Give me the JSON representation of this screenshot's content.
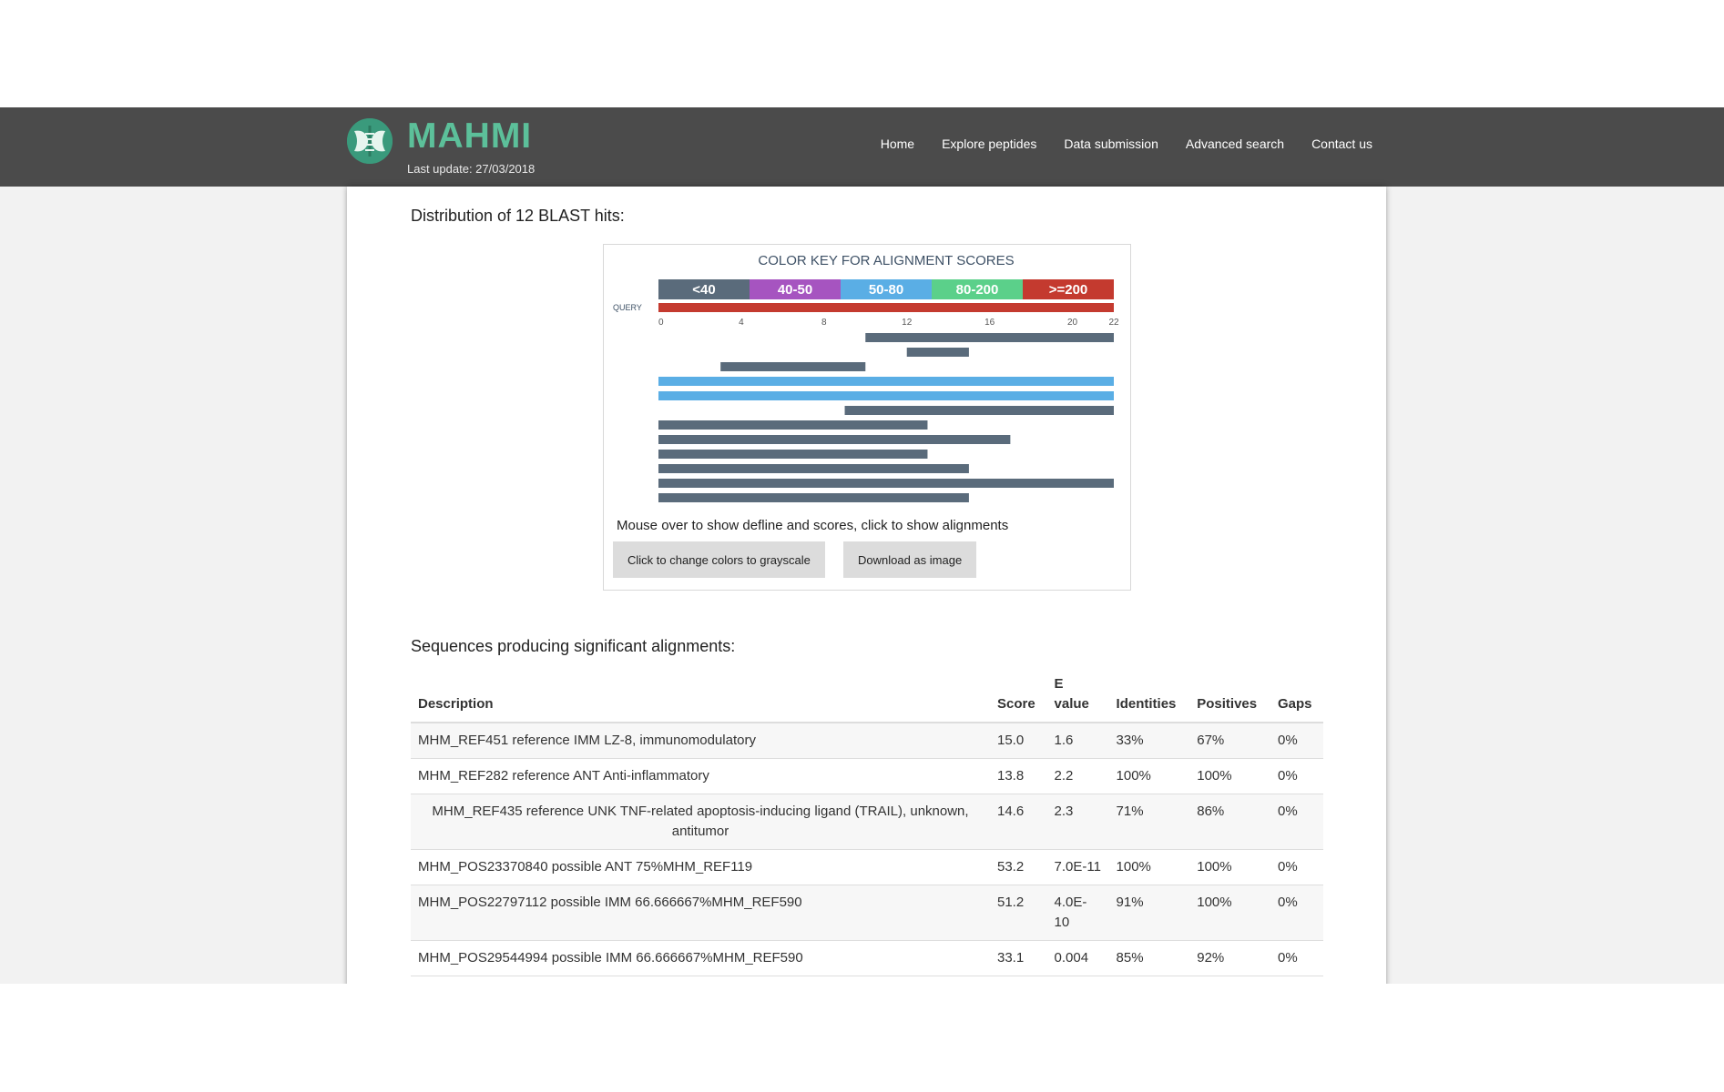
{
  "header": {
    "brand": "MAHMI",
    "last_update": "Last update: 27/03/2018",
    "nav": [
      "Home",
      "Explore peptides",
      "Data submission",
      "Advanced search",
      "Contact us"
    ]
  },
  "distribution": {
    "title": "Distribution of 12 BLAST hits:",
    "color_key_title": "COLOR KEY FOR ALIGNMENT SCORES",
    "score_bins": [
      {
        "label": "<40",
        "color": "#5a6b7b"
      },
      {
        "label": "40-50",
        "color": "#a654c0"
      },
      {
        "label": "50-80",
        "color": "#5aaee5"
      },
      {
        "label": "80-200",
        "color": "#5bd08a"
      },
      {
        "label": ">=200",
        "color": "#c43a2f"
      }
    ],
    "query_label": "QUERY",
    "query_color": "#c43a2f",
    "query_length": 22,
    "ticks": [
      "0",
      "4",
      "8",
      "12",
      "16",
      "20",
      "22"
    ],
    "hits": [
      {
        "start": 10,
        "end": 22,
        "bin": 0
      },
      {
        "start": 12,
        "end": 15,
        "bin": 0
      },
      {
        "start": 3,
        "end": 10,
        "bin": 0
      },
      {
        "start": 0,
        "end": 22,
        "bin": 2
      },
      {
        "start": 0,
        "end": 22,
        "bin": 2
      },
      {
        "start": 9,
        "end": 22,
        "bin": 0
      },
      {
        "start": 0,
        "end": 13,
        "bin": 0
      },
      {
        "start": 0,
        "end": 17,
        "bin": 0
      },
      {
        "start": 0,
        "end": 13,
        "bin": 0
      },
      {
        "start": 0,
        "end": 15,
        "bin": 0
      },
      {
        "start": 0,
        "end": 22,
        "bin": 0
      },
      {
        "start": 0,
        "end": 15,
        "bin": 0
      }
    ],
    "hint": "Mouse over to show defline and scores, click to show alignments",
    "grayscale_button": "Click to change colors to grayscale",
    "download_button": "Download as image"
  },
  "alignments": {
    "title": "Sequences producing significant alignments:",
    "columns": {
      "description": "Description",
      "score": "Score",
      "evalue_1": "E",
      "evalue_2": "value",
      "identities": "Identities",
      "positives": "Positives",
      "gaps": "Gaps"
    },
    "rows": [
      {
        "description": "MHM_REF451 reference IMM LZ-8, immunomodulatory",
        "score": "15.0",
        "evalue": "1.6",
        "identities": "33%",
        "positives": "67%",
        "gaps": "0%"
      },
      {
        "description": "MHM_REF282 reference ANT Anti-inflammatory",
        "score": "13.8",
        "evalue": "2.2",
        "identities": "100%",
        "positives": "100%",
        "gaps": "0%"
      },
      {
        "description": "MHM_REF435 reference UNK TNF-related apoptosis-inducing ligand (TRAIL), unknown, antitumor",
        "score": "14.6",
        "evalue": "2.3",
        "identities": "71%",
        "positives": "86%",
        "gaps": "0%"
      },
      {
        "description": "MHM_POS23370840 possible ANT 75%MHM_REF119",
        "score": "53.2",
        "evalue": "7.0E-11",
        "identities": "100%",
        "positives": "100%",
        "gaps": "0%"
      },
      {
        "description": "MHM_POS22797112 possible IMM 66.666667%MHM_REF590",
        "score": "51.2",
        "evalue": "4.0E-10",
        "identities": "91%",
        "positives": "100%",
        "gaps": "0%"
      },
      {
        "description": "MHM_POS29544994 possible IMM 66.666667%MHM_REF590",
        "score": "33.1",
        "evalue": "0.004",
        "identities": "85%",
        "positives": "92%",
        "gaps": "0%"
      }
    ]
  }
}
